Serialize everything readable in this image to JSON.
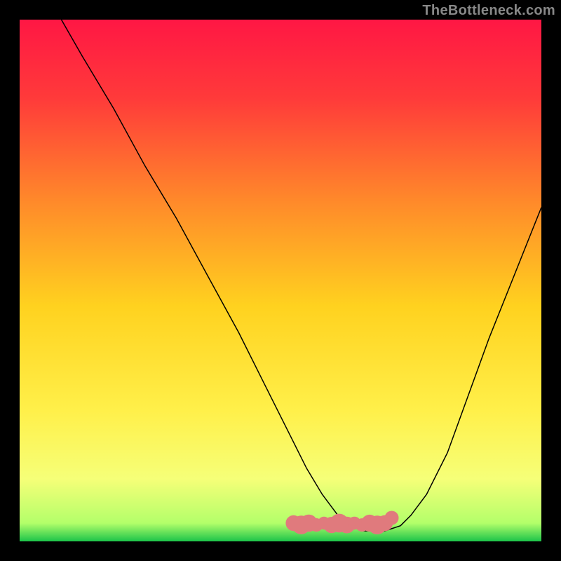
{
  "watermark": "TheBottleneck.com",
  "chart_data": {
    "type": "line",
    "title": "",
    "xlabel": "",
    "ylabel": "",
    "xlim": [
      0,
      100
    ],
    "ylim": [
      0,
      100
    ],
    "gradient_stops": [
      {
        "offset": 0.0,
        "color": "#ff1744"
      },
      {
        "offset": 0.15,
        "color": "#ff3a3a"
      },
      {
        "offset": 0.35,
        "color": "#ff8a2a"
      },
      {
        "offset": 0.55,
        "color": "#ffd21f"
      },
      {
        "offset": 0.75,
        "color": "#fff04a"
      },
      {
        "offset": 0.88,
        "color": "#f6ff78"
      },
      {
        "offset": 0.965,
        "color": "#b3ff6a"
      },
      {
        "offset": 1.0,
        "color": "#1cc44a"
      }
    ],
    "series": [
      {
        "name": "bottleneck-curve",
        "color": "#000000",
        "stroke_width": 1.5,
        "x": [
          8,
          12,
          18,
          24,
          30,
          36,
          42,
          48,
          52,
          55,
          58,
          61,
          63,
          66,
          70,
          73,
          75,
          78,
          82,
          86,
          90,
          94,
          98,
          100
        ],
        "y": [
          100,
          93,
          83,
          72,
          62,
          51,
          40,
          28,
          20,
          14,
          9,
          5,
          3,
          2,
          2,
          3,
          5,
          9,
          17,
          28,
          39,
          49,
          59,
          64
        ]
      }
    ],
    "optimal_band": {
      "color": "#e07a7d",
      "x_start_frac": 0.525,
      "x_end_frac": 0.7,
      "y_frac": 0.965,
      "height_frac": 0.03,
      "dot_x_frac": 0.713,
      "dot_y_frac": 0.955
    }
  }
}
